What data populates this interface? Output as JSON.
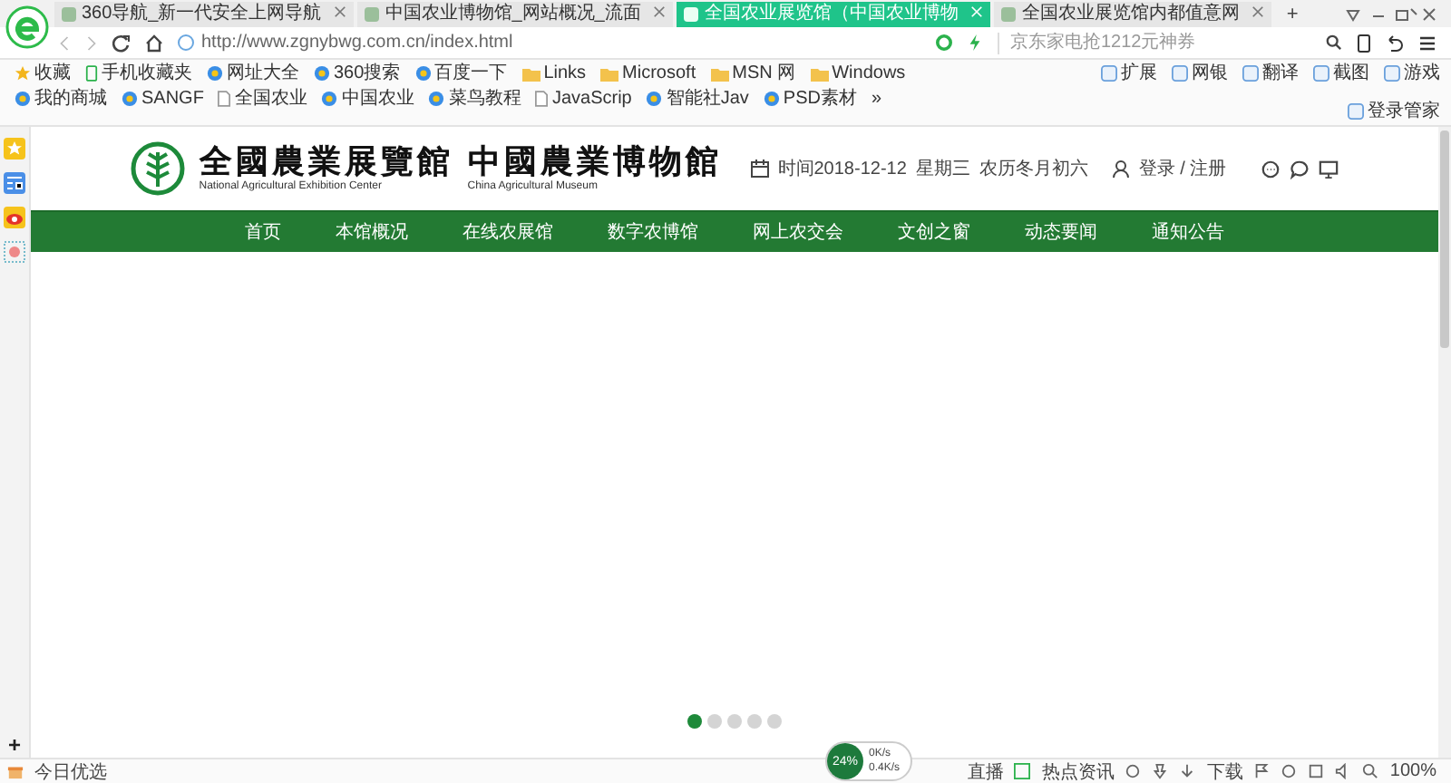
{
  "browser": {
    "tabs": [
      {
        "title": "360导航_新一代安全上网导航",
        "selected": false
      },
      {
        "title": "中国农业博物馆_网站概况_流面",
        "selected": false
      },
      {
        "title": "全国农业展览馆（中国农业博物",
        "selected": true
      },
      {
        "title": "全国农业展览馆内都值意网",
        "selected": false
      }
    ],
    "new_tab": "+",
    "address": "http://www.zgnybwg.com.cn/index.html",
    "search_placeholder": "京东家电抢1212元神券",
    "bookmarks": [
      {
        "label": "收藏",
        "kind": "star"
      },
      {
        "label": "手机收藏夹",
        "kind": "phone"
      },
      {
        "label": "网址大全",
        "kind": "site"
      },
      {
        "label": "360搜索",
        "kind": "site"
      },
      {
        "label": "百度一下",
        "kind": "site"
      },
      {
        "label": "Links",
        "kind": "folder"
      },
      {
        "label": "Microsoft",
        "kind": "folder"
      },
      {
        "label": "MSN 网",
        "kind": "folder"
      },
      {
        "label": "Windows",
        "kind": "folder"
      },
      {
        "label": "我的商城",
        "kind": "site"
      },
      {
        "label": "SANGF",
        "kind": "site"
      },
      {
        "label": "全国农业",
        "kind": "page"
      },
      {
        "label": "中国农业",
        "kind": "site"
      },
      {
        "label": "菜鸟教程",
        "kind": "site"
      },
      {
        "label": "JavaScrip",
        "kind": "page"
      },
      {
        "label": "智能社Jav",
        "kind": "site"
      },
      {
        "label": "PSD素材",
        "kind": "site"
      }
    ],
    "bookmark_more": "»",
    "tools": [
      {
        "label": "扩展"
      },
      {
        "label": "网银"
      },
      {
        "label": "翻译"
      },
      {
        "label": "截图"
      },
      {
        "label": "游戏"
      },
      {
        "label": "登录管家"
      }
    ]
  },
  "page": {
    "logo_cn_1": "全國農業展覽館",
    "logo_en_1": "National Agricultural Exhibition Center",
    "logo_cn_2": "中國農業博物館",
    "logo_en_2": "China Agricultural Museum",
    "date": "时间2018-12-12",
    "weekday": "星期三",
    "lunar": "农历冬月初六",
    "login": "登录 / 注册",
    "nav": [
      "首页",
      "本馆概况",
      "在线农展馆",
      "数字农博馆",
      "网上农交会",
      "文创之窗",
      "动态要闻",
      "通知公告"
    ],
    "carousel_dots": [
      {
        "selected": true
      },
      {
        "selected": false
      },
      {
        "selected": false
      },
      {
        "selected": false
      },
      {
        "selected": false
      }
    ]
  },
  "sidebar_add": "+",
  "status_bar": {
    "left": "今日优选",
    "speed": {
      "percent": "24%",
      "up": "0K/s",
      "down": "0.4K/s"
    },
    "live": "直播",
    "news": "热点资讯",
    "download": "下载",
    "zoom": "100%"
  }
}
